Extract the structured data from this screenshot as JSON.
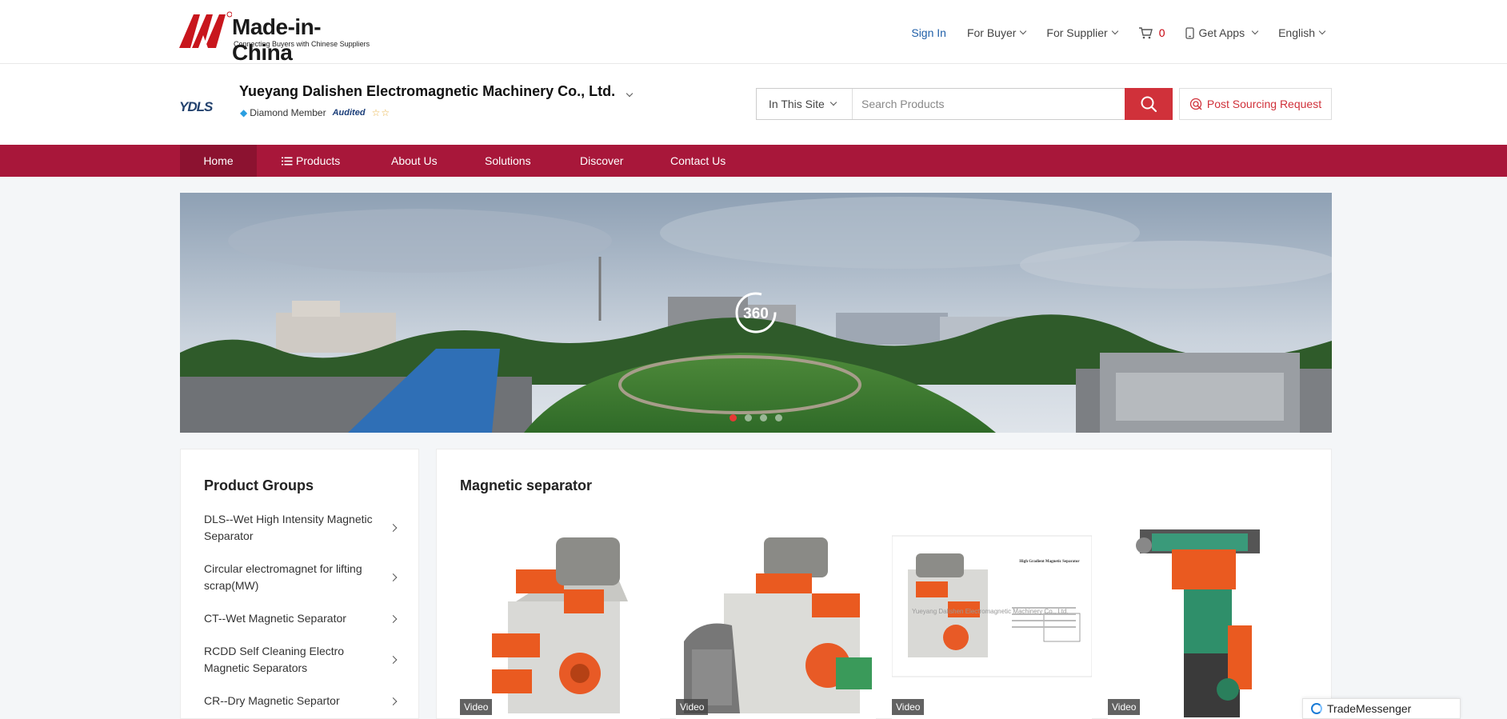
{
  "header": {
    "logo_text": "Made-in-China",
    "logo_tagline": "Connecting Buyers with Chinese Suppliers",
    "nav": {
      "sign_in": "Sign In",
      "for_buyer": "For Buyer",
      "for_supplier": "For Supplier",
      "cart_count": "0",
      "get_apps": "Get Apps",
      "language": "English"
    }
  },
  "company": {
    "logo_text": "YDLS",
    "name": "Yueyang Dalishen Electromagnetic Machinery Co., Ltd.",
    "membership": "Diamond Member",
    "audited": "Audited",
    "stars": "☆☆"
  },
  "search": {
    "scope": "In This Site",
    "placeholder": "Search Products",
    "post_sourcing": "Post Sourcing Request"
  },
  "main_nav": {
    "home": "Home",
    "products": "Products",
    "about": "About Us",
    "solutions": "Solutions",
    "discover": "Discover",
    "contact": "Contact Us"
  },
  "banner": {
    "badge": "360",
    "slides": 4,
    "active_slide": 1
  },
  "sidebar": {
    "title": "Product Groups",
    "groups": [
      "DLS--Wet High Intensity Magnetic Separator",
      "Circular electromagnet for lifting scrap(MW)",
      "CT--Wet Magnetic Separator",
      "RCDD Self Cleaning Electro Magnetic Separators",
      "CR--Dry Magnetic Separtor"
    ]
  },
  "section": {
    "title": "Magnetic separator",
    "products": [
      {
        "tag": "Video"
      },
      {
        "tag": "Video"
      },
      {
        "tag": "Video",
        "doc_title": "High Gradient Magnetic Separator",
        "watermark": "Yueyang Dalishen Electromagnetic Machinery Co., Ltd."
      },
      {
        "tag": "Video"
      }
    ]
  },
  "messenger": {
    "label": "TradeMessenger"
  },
  "colors": {
    "brand_red": "#a8173a",
    "search_red": "#d0313a",
    "link_blue": "#1f5fa8"
  }
}
